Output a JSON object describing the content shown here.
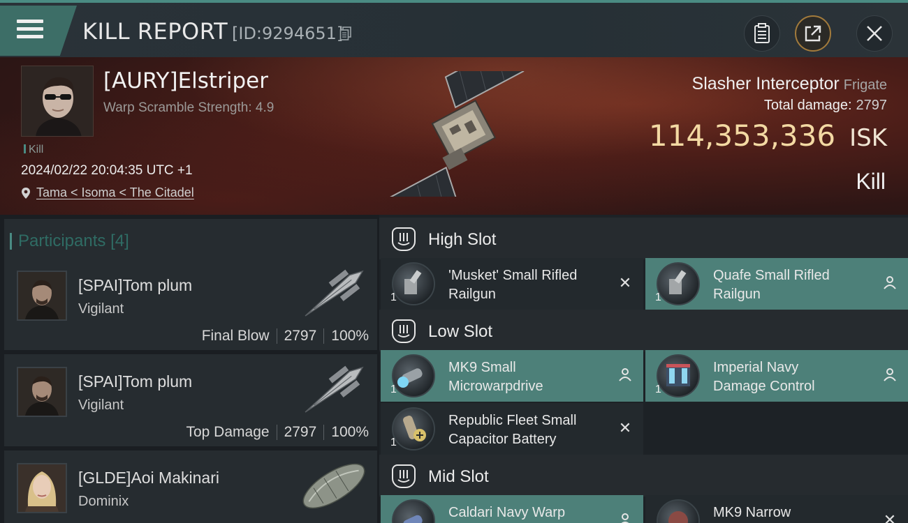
{
  "header": {
    "title": "KILL REPORT",
    "report_id": "[ID:9294651]",
    "buttons": [
      "clipboard",
      "share",
      "close"
    ]
  },
  "victim": {
    "name": "[AURY]Elstriper",
    "scramble": "Warp Scramble Strength: 4.9",
    "tag": "Kill",
    "timestamp": "2024/02/22 20:04:35 UTC +1",
    "location": "Tama < Isoma < The Citadel",
    "ship_name": "Slasher Interceptor",
    "ship_class": "Frigate",
    "total_damage_label": "Total damage:",
    "total_damage": "2797",
    "isk_value": "114,353,336",
    "isk_unit": "ISK",
    "result": "Kill"
  },
  "participants": {
    "title": "Participants",
    "count": "[4]",
    "list": [
      {
        "name": "[SPAI]Tom plum",
        "ship": "Vigilant",
        "role": "Final Blow",
        "damage": "2797",
        "percent": "100%"
      },
      {
        "name": "[SPAI]Tom plum",
        "ship": "Vigilant",
        "role": "Top Damage",
        "damage": "2797",
        "percent": "100%"
      },
      {
        "name": "[GLDE]Aoi Makinari",
        "ship": "Dominix",
        "role": "",
        "damage": "",
        "percent": ""
      }
    ]
  },
  "slots": {
    "high": {
      "title": "High Slot",
      "modules": [
        {
          "name_line1": "'Musket' Small Rifled",
          "name_line2": "Railgun",
          "qty": "1",
          "status": "destroyed"
        },
        {
          "name_line1": "Quafe Small Rifled",
          "name_line2": "Railgun",
          "qty": "1",
          "status": "dropped"
        }
      ]
    },
    "low": {
      "title": "Low Slot",
      "modules": [
        {
          "name_line1": "MK9 Small",
          "name_line2": "Microwarpdrive",
          "qty": "1",
          "status": "dropped"
        },
        {
          "name_line1": "Imperial Navy",
          "name_line2": "Damage Control",
          "qty": "1",
          "status": "dropped"
        },
        {
          "name_line1": "Republic Fleet Small",
          "name_line2": "Capacitor Battery",
          "qty": "1",
          "status": "destroyed"
        }
      ]
    },
    "mid": {
      "title": "Mid Slot",
      "modules": [
        {
          "name_line1": "Caldari Navy Warp",
          "name_line2": "",
          "qty": "",
          "status": "dropped"
        },
        {
          "name_line1": "MK9 Narrow",
          "name_line2": "",
          "qty": "",
          "status": "destroyed"
        }
      ]
    }
  },
  "colors": {
    "accent_teal": "#4d8079",
    "isk_gold": "#f3d9a3",
    "banner_red": "#4a1d18"
  }
}
